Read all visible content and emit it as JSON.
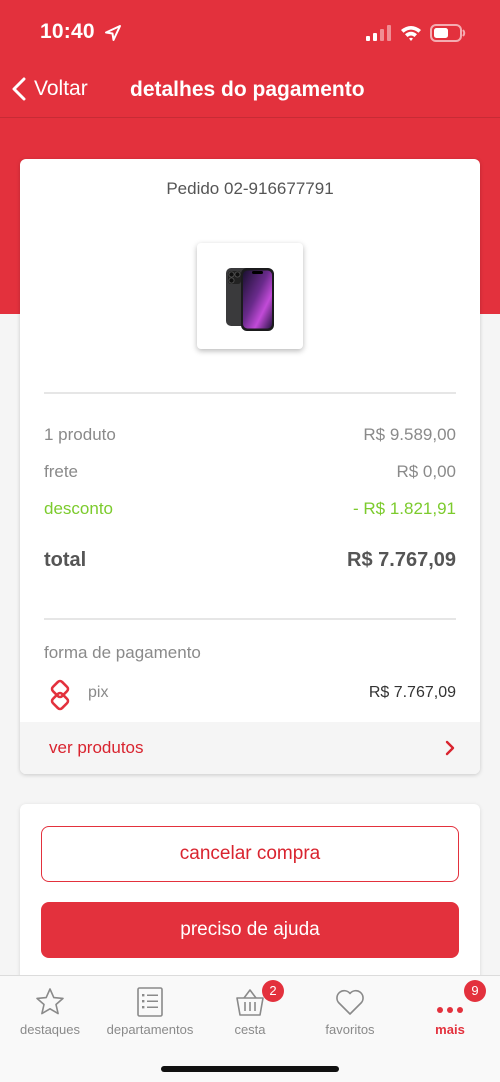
{
  "status_bar": {
    "time": "10:40"
  },
  "nav": {
    "back_label": "Voltar",
    "title": "detalhes do pagamento"
  },
  "order": {
    "number_label": "Pedido 02-916677791",
    "product_image": "iphone-13-pro-graphite",
    "summary": [
      {
        "label": "1 produto",
        "value": "R$ 9.589,00"
      },
      {
        "label": "frete",
        "value": "R$ 0,00"
      },
      {
        "label": "desconto",
        "value": "- R$ 1.821,91"
      }
    ],
    "total_label": "total",
    "total_value": "R$ 7.767,09",
    "payment": {
      "heading": "forma de pagamento",
      "method_icon": "pix-icon",
      "method_label": "pix",
      "amount": "R$ 7.767,09"
    },
    "ver_produtos_label": "ver produtos"
  },
  "actions": {
    "cancel_label": "cancelar compra",
    "help_label": "preciso de ajuda"
  },
  "tabs": [
    {
      "label": "destaques",
      "icon": "star-icon"
    },
    {
      "label": "departamentos",
      "icon": "list-icon"
    },
    {
      "label": "cesta",
      "icon": "basket-icon",
      "badge": "2"
    },
    {
      "label": "favoritos",
      "icon": "heart-icon"
    },
    {
      "label": "mais",
      "icon": "more-icon",
      "badge": "9",
      "active": true
    }
  ],
  "colors": {
    "brand_red": "#e3313d",
    "discount_green": "#7ccb2d",
    "muted_text": "#8a8a8a"
  }
}
